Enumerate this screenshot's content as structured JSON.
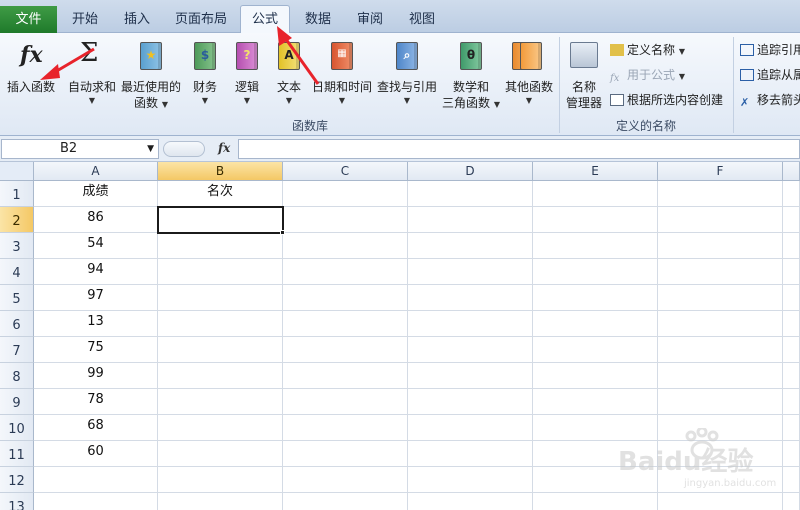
{
  "tabs": {
    "file": "文件",
    "items": [
      "开始",
      "插入",
      "页面布局",
      "公式",
      "数据",
      "审阅",
      "视图"
    ],
    "active": "公式"
  },
  "ribbon": {
    "insert_function": "插入函数",
    "autosum": "自动求和",
    "recent": [
      "最近使用的",
      "函数"
    ],
    "financial": "财务",
    "logical": "逻辑",
    "text": "文本",
    "datetime": "日期和时间",
    "lookup": "查找与引用",
    "math": [
      "数学和",
      "三角函数"
    ],
    "more": "其他函数",
    "library_group": "函数库",
    "name_manager": [
      "名称",
      "管理器"
    ],
    "define_name": "定义名称",
    "use_in_formula": "用于公式",
    "create_from_selection": "根据所选内容创建",
    "names_group": "定义的名称",
    "trace_precedents": "追踪引用",
    "trace_dependents": "追踪从属",
    "remove_arrows": "移去箭头"
  },
  "formula_bar": {
    "name_box": "B2",
    "fx": "fx",
    "formula": ""
  },
  "sheet": {
    "columns": [
      "A",
      "B",
      "C",
      "D",
      "E",
      "F"
    ],
    "selected_column": "B",
    "selected_row": "2",
    "rows": [
      {
        "num": "1",
        "a": "成绩",
        "b": "名次"
      },
      {
        "num": "2",
        "a": "86",
        "b": ""
      },
      {
        "num": "3",
        "a": "54",
        "b": ""
      },
      {
        "num": "4",
        "a": "94",
        "b": ""
      },
      {
        "num": "5",
        "a": "97",
        "b": ""
      },
      {
        "num": "6",
        "a": "13",
        "b": ""
      },
      {
        "num": "7",
        "a": "75",
        "b": ""
      },
      {
        "num": "8",
        "a": "99",
        "b": ""
      },
      {
        "num": "9",
        "a": "78",
        "b": ""
      },
      {
        "num": "10",
        "a": "68",
        "b": ""
      },
      {
        "num": "11",
        "a": "60",
        "b": ""
      },
      {
        "num": "12",
        "a": "",
        "b": ""
      },
      {
        "num": "13",
        "a": "",
        "b": ""
      }
    ]
  },
  "watermark": {
    "brand": "Baidu经验",
    "url": "jingyan.baidu.com"
  },
  "colors": {
    "file_tab": "#1f7a2b",
    "selection_header": "#f4c865",
    "annotation_arrow": "#e8232b"
  }
}
